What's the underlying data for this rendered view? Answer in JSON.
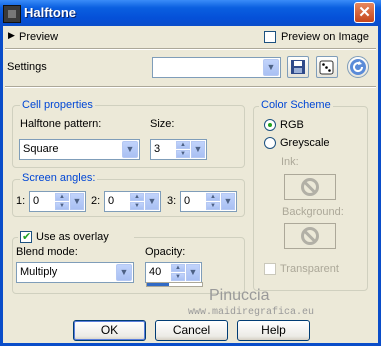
{
  "window": {
    "title": "Halftone",
    "close_glyph": "✕"
  },
  "preview": {
    "toggle_label": "Preview",
    "on_image_label": "Preview on Image",
    "on_image_checked": false
  },
  "settings": {
    "label": "Settings",
    "preset_value": ""
  },
  "cell_properties": {
    "legend": "Cell properties",
    "pattern_label": "Halftone pattern:",
    "pattern_value": "Square",
    "size_label": "Size:",
    "size_value": "3"
  },
  "screen_angles": {
    "legend": "Screen angles:",
    "angles": [
      {
        "label": "1:",
        "value": "0"
      },
      {
        "label": "2:",
        "value": "0"
      },
      {
        "label": "3:",
        "value": "0"
      }
    ]
  },
  "overlay": {
    "checkbox_label": "Use as overlay",
    "checked": true,
    "blend_label": "Blend mode:",
    "blend_value": "Multiply",
    "opacity_label": "Opacity:",
    "opacity_value": "40",
    "opacity_fraction": 0.4
  },
  "color_scheme": {
    "legend": "Color Scheme",
    "options": [
      {
        "label": "RGB",
        "selected": true
      },
      {
        "label": "Greyscale",
        "selected": false
      }
    ],
    "ink_label": "Ink:",
    "background_label": "Background:",
    "transparent_label": "Transparent",
    "transparent_checked": false
  },
  "watermark": {
    "line1": "Pinuccia",
    "line2": "www.maidiregrafica.eu"
  },
  "buttons": {
    "ok": "OK",
    "cancel": "Cancel",
    "help": "Help"
  },
  "colors": {
    "titlebar": "#0A5FE0",
    "dialog_bg": "#ECE9D8",
    "legend_text": "#0046D5",
    "close_button": "#D2542A"
  }
}
